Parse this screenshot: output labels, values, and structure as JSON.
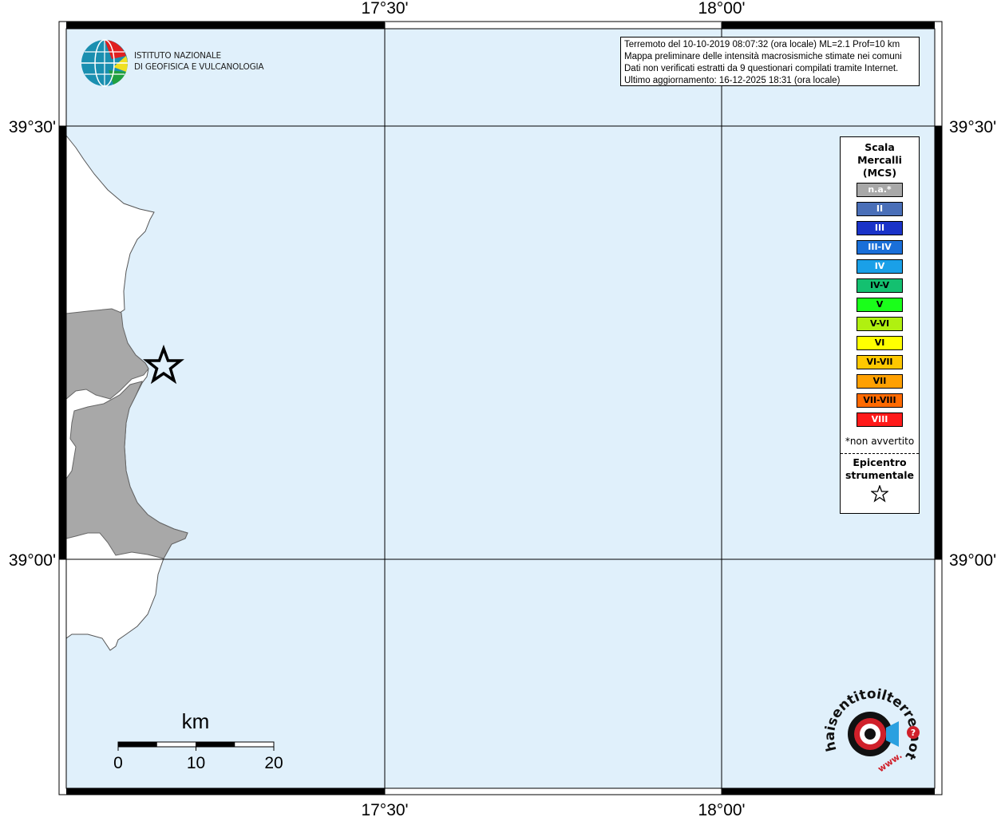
{
  "map": {
    "lon_labels": [
      "17°30'",
      "18°00'"
    ],
    "lat_labels": [
      "39°30'",
      "39°00'"
    ],
    "colors": {
      "sea": "#e0f0fb",
      "land": "#ffffff",
      "affected_area": "#a8a8a8",
      "frame": "#000000"
    }
  },
  "info": {
    "line1": "Terremoto del 10-10-2019 08:07:32 (ora locale) ML=2.1 Prof=10 km",
    "line2": "Mappa preliminare delle intensità macrosismiche stimate nei comuni",
    "line3": "Dati non verificati estratti da 9 questionari compilati tramite Internet.",
    "line4": "Ultimo aggiornamento: 16-12-2025 18:31 (ora locale)"
  },
  "institute": {
    "line1": "ISTITUTO NAZIONALE",
    "line2": "DI GEOFISICA E VULCANOLOGIA"
  },
  "legend": {
    "title_line1": "Scala",
    "title_line2": "Mercalli",
    "title_line3": "(MCS)",
    "items": [
      {
        "label": "n.a.*",
        "color": "#a8a8a8",
        "text_color": "#ffffff"
      },
      {
        "label": "II",
        "color": "#4a6fb8",
        "text_color": "#ffffff"
      },
      {
        "label": "III",
        "color": "#1a33c8",
        "text_color": "#ffffff"
      },
      {
        "label": "III-IV",
        "color": "#1a6fd8",
        "text_color": "#ffffff"
      },
      {
        "label": "IV",
        "color": "#1aa0e8",
        "text_color": "#ffffff"
      },
      {
        "label": "IV-V",
        "color": "#14c070",
        "text_color": "#000000"
      },
      {
        "label": "V",
        "color": "#1aff1a",
        "text_color": "#000000"
      },
      {
        "label": "V-VI",
        "color": "#b0f010",
        "text_color": "#000000"
      },
      {
        "label": "VI",
        "color": "#ffff00",
        "text_color": "#000000"
      },
      {
        "label": "VI-VII",
        "color": "#ffc800",
        "text_color": "#000000"
      },
      {
        "label": "VII",
        "color": "#ffa000",
        "text_color": "#000000"
      },
      {
        "label": "VII-VIII",
        "color": "#ff6a00",
        "text_color": "#000000"
      },
      {
        "label": "VIII",
        "color": "#ff1a1a",
        "text_color": "#ffffff"
      }
    ],
    "na_note": "*non avvertito",
    "epicenter_line1": "Epicentro",
    "epicenter_line2": "strumentale"
  },
  "scale": {
    "unit": "km",
    "ticks": [
      "0",
      "10",
      "20"
    ]
  },
  "brand": {
    "text": "haisentitoilterremoto.it",
    "prefix": "www."
  }
}
